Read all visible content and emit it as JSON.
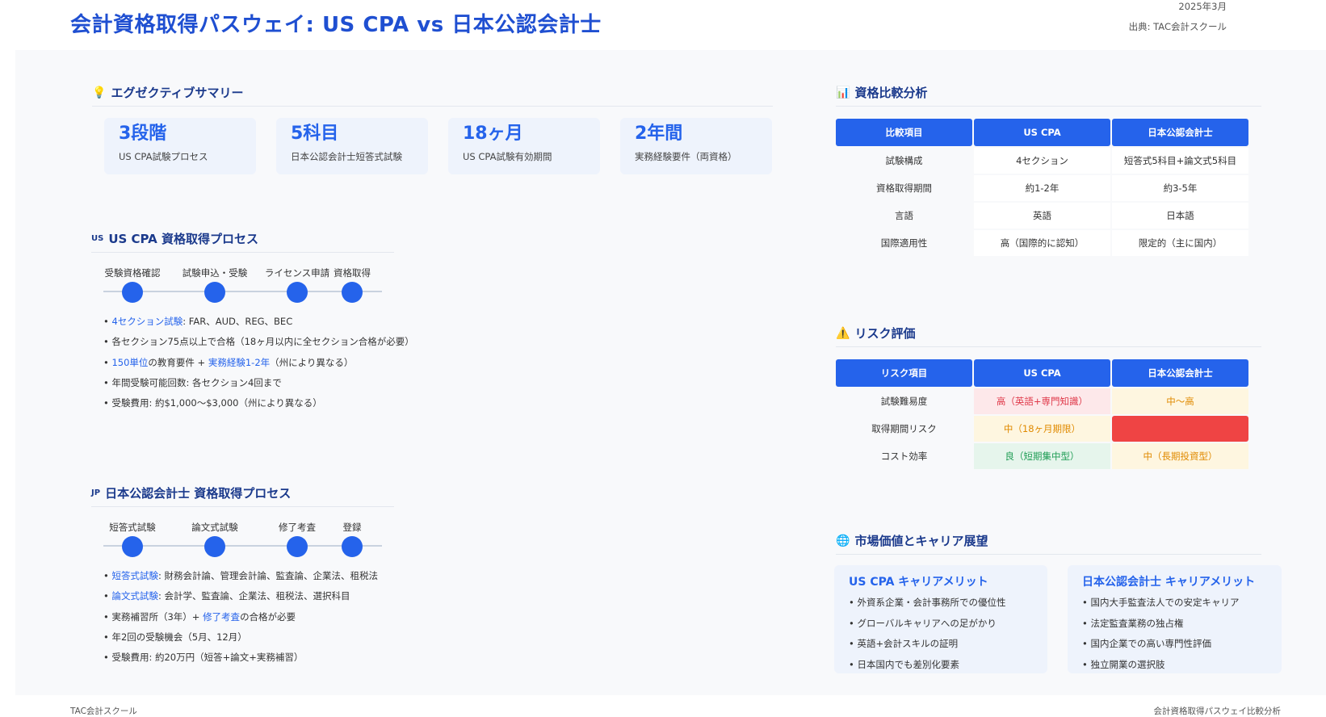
{
  "header": {
    "title": "会計資格取得パスウェイ: US CPA vs 日本公認会計士",
    "date": "2025年3月",
    "source": "出典: TAC会計スクール"
  },
  "summary": {
    "heading": "エグゼクティブサマリー",
    "icon": "lightbulb-icon",
    "kpis": [
      {
        "value": "3段階",
        "label": "US CPA試験プロセス"
      },
      {
        "value": "5科目",
        "label": "日本公認会計士短答式試験"
      },
      {
        "value": "18ヶ月",
        "label": "US CPA試験有効期間"
      },
      {
        "value": "2年間",
        "label": "実務経験要件（両資格）"
      }
    ]
  },
  "us_process": {
    "flag": "US",
    "heading": "US CPA 資格取得プロセス",
    "steps": [
      "受験資格確認",
      "試験申込・受験",
      "ライセンス申請",
      "資格取得"
    ],
    "bullets": [
      {
        "hl1": "4セクション試験",
        "t1": ": FAR、AUD、REG、BEC"
      },
      {
        "t1": "各セクション75点以上で合格（18ヶ月以内に全セクション合格が必要）"
      },
      {
        "hl1": "150単位",
        "t1": "の教育要件 + ",
        "hl2": "実務経験1-2年",
        "t2": "（州により異なる）"
      },
      {
        "t1": "年間受験可能回数: 各セクション4回まで"
      },
      {
        "t1": "受験費用: 約$1,000〜$3,000（州により異なる）"
      }
    ]
  },
  "jp_process": {
    "flag": "JP",
    "heading": "日本公認会計士 資格取得プロセス",
    "steps": [
      "短答式試験",
      "論文式試験",
      "修了考査",
      "登録"
    ],
    "bullets": [
      {
        "hl1": "短答式試験",
        "t1": ": 財務会計論、管理会計論、監査論、企業法、租税法"
      },
      {
        "hl1": "論文式試験",
        "t1": ": 会計学、監査論、企業法、租税法、選択科目"
      },
      {
        "t1": "実務補習所（3年）+ ",
        "hl2": "修了考査",
        "t2": "の合格が必要"
      },
      {
        "t1": "年2回の受験機会（5月、12月）"
      },
      {
        "t1": "受験費用: 約20万円（短答+論文+実務補習）"
      }
    ]
  },
  "comparison": {
    "heading": "資格比較分析",
    "icon": "bar-chart-icon",
    "headers": [
      "比較項目",
      "US CPA",
      "日本公認会計士"
    ],
    "rows": [
      [
        "試験構成",
        "4セクション",
        "短答式5科目+論文式5科目"
      ],
      [
        "資格取得期間",
        "約1-2年",
        "約3-5年"
      ],
      [
        "言語",
        "英語",
        "日本語"
      ],
      [
        "国際適用性",
        "高（国際的に認知）",
        "限定的（主に国内）"
      ]
    ]
  },
  "risk": {
    "heading": "リスク評価",
    "icon": "warning-icon",
    "headers": [
      "リスク項目",
      "US CPA",
      "日本公認会計士"
    ],
    "rows": [
      {
        "item": "試験難易度",
        "us": "高（英語+専門知識）",
        "us_level": "red",
        "jp": "中〜高",
        "jp_level": "yel"
      },
      {
        "item": "取得期間リスク",
        "us": "中（18ヶ月期限）",
        "us_level": "yel",
        "jp": "",
        "jp_level": "solidred"
      },
      {
        "item": "コスト効率",
        "us": "良（短期集中型）",
        "us_level": "grn",
        "jp": "中（長期投資型）",
        "jp_level": "yel"
      }
    ],
    "colors": {
      "red": "#e0394a",
      "yellow": "#e08a00",
      "green": "#1f9d55",
      "solid_red": "#ef4444"
    }
  },
  "career": {
    "heading": "市場価値とキャリア展望",
    "icon": "globe-icon",
    "cards": [
      {
        "title": "US CPA キャリアメリット",
        "items": [
          "外資系企業・会計事務所での優位性",
          "グローバルキャリアへの足がかり",
          "英語+会計スキルの証明",
          "日本国内でも差別化要素"
        ]
      },
      {
        "title": "日本公認会計士 キャリアメリット",
        "items": [
          "国内大手監査法人での安定キャリア",
          "法定監査業務の独占権",
          "国内企業での高い専門性評価",
          "独立開業の選択肢"
        ]
      }
    ]
  },
  "footer": {
    "left": "TAC会計スクール",
    "right": "会計資格取得パスウェイ比較分析"
  },
  "accent_color": "#2563eb"
}
